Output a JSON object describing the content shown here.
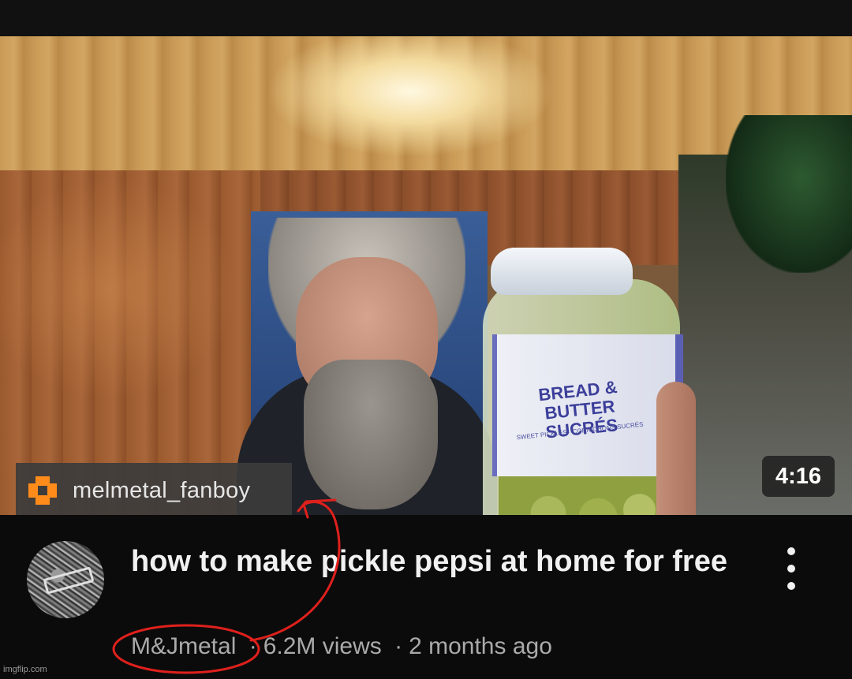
{
  "thumbnail": {
    "jar_label_line1": "BREAD & BUTTER",
    "jar_label_line2": "SUCRÉS",
    "jar_label_small": "SWEET PICKLES · CORNICHONS SUCRÉS",
    "duration": "4:16"
  },
  "watermark": {
    "icon": "orange-badge-icon",
    "username": "melmetal_fanboy",
    "accent_color": "#ff8c1a"
  },
  "video": {
    "title": "how to make pickle  pepsi at home for free",
    "channel": "M&Jmetal",
    "separator": "·",
    "views": "6.2M views",
    "age": "2 months ago",
    "menu_icon": "more-vertical-icon"
  },
  "annotation": {
    "color": "#e0201c"
  },
  "footer": {
    "credit": "imgflip.com"
  }
}
